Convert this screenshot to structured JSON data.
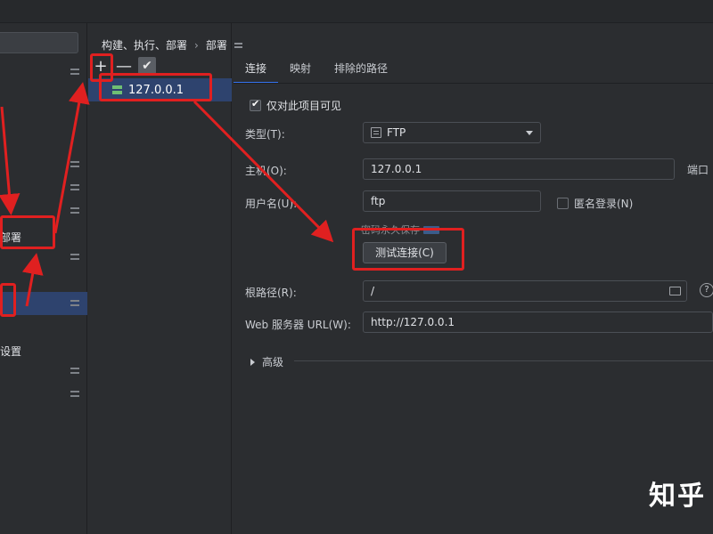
{
  "breadcrumb": {
    "part1": "构建、执行、部署",
    "separator": "›",
    "part2": "部署"
  },
  "sidebar": {
    "item_deploy": "部署",
    "item_settings": "设置"
  },
  "toolbar": {
    "add": "+",
    "remove": "—",
    "apply": "✔"
  },
  "server_list": {
    "items": [
      {
        "label": "127.0.0.1"
      }
    ]
  },
  "tabs": [
    {
      "label": "连接"
    },
    {
      "label": "映射"
    },
    {
      "label": "排除的路径"
    }
  ],
  "form": {
    "visible_only_label": "仅对此项目可见",
    "type_label": "类型(T):",
    "type_value": "FTP",
    "host_label": "主机(O):",
    "host_value": "127.0.0.1",
    "port_label": "端口",
    "username_label": "用户名(U):",
    "username_value": "ftp",
    "anonymous_label": "匿名登录(N)",
    "save_password_label": "密码永久保存",
    "test_connection_label": "测试连接(C)",
    "root_path_label": "根路径(R):",
    "root_path_value": "/",
    "help_glyph": "?",
    "web_url_label": "Web 服务器 URL(W):",
    "web_url_value": "http://127.0.0.1",
    "advanced_label": "高级"
  },
  "watermark": "知乎",
  "colors": {
    "background": "#2b2d30",
    "selection": "#2e436e",
    "accent": "#3574f0",
    "annotation": "#e02020"
  }
}
